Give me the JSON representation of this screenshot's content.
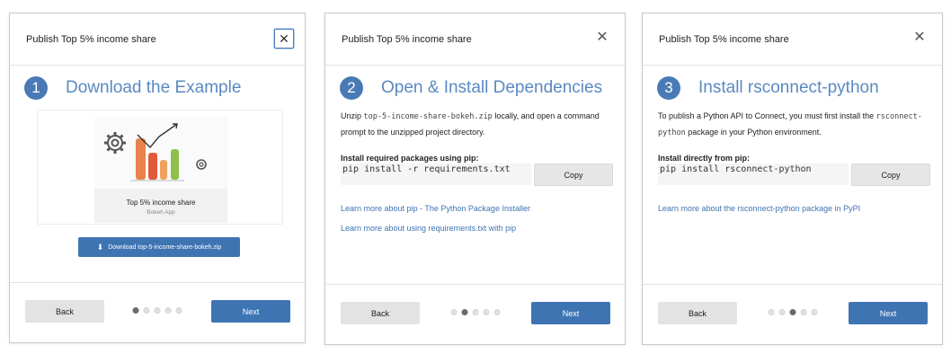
{
  "dialogs": [
    {
      "title": "Publish Top 5% income share",
      "step": {
        "number": "1",
        "title": "Download the Example"
      },
      "card": {
        "name": "Top 5% income share",
        "type": "Bokeh App"
      },
      "download_label": "Download top-5-income-share-bokeh.zip",
      "back_label": "Back",
      "next_label": "Next",
      "dots": {
        "count": 5,
        "active": 1
      }
    },
    {
      "title": "Publish Top 5% income share",
      "step": {
        "number": "2",
        "title": "Open & Install Dependencies"
      },
      "desc_pre": "Unzip ",
      "desc_code": "top-5-income-share-bokeh.zip",
      "desc_post": " locally, and open a command prompt to the unzipped project directory.",
      "pip_label": "Install required packages using pip:",
      "command": "pip install -r requirements.txt",
      "copy_label": "Copy",
      "links": [
        "Learn more about pip - The Python Package Installer",
        "Learn more about using requirements.txt with pip"
      ],
      "back_label": "Back",
      "next_label": "Next",
      "dots": {
        "count": 5,
        "active": 2
      }
    },
    {
      "title": "Publish Top 5% income share",
      "step": {
        "number": "3",
        "title": "Install rsconnect-python"
      },
      "desc_pre": "To publish a Python API to Connect, you must first install the ",
      "desc_code": "rsconnect-python",
      "desc_post": " package in your Python environment.",
      "pip_label": "Install directly from pip:",
      "command": "pip install rsconnect-python",
      "copy_label": "Copy",
      "links": [
        "Learn more about the rsconnect-python package in PyPI"
      ],
      "back_label": "Back",
      "next_label": "Next",
      "dots": {
        "count": 5,
        "active": 3
      }
    }
  ],
  "icons": {
    "close": "close-icon",
    "download": "download-icon",
    "thumbnail": "chart-thumbnail-icon"
  },
  "colors": {
    "accent": "#3f74b3",
    "step_title": "#5a89c2",
    "link": "#3f74b3"
  }
}
